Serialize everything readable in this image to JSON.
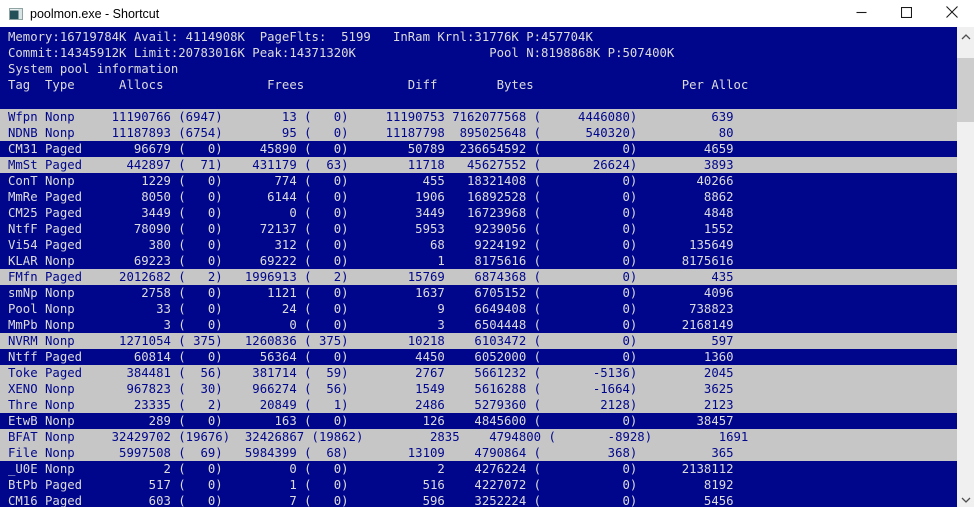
{
  "window": {
    "title": "poolmon.exe - Shortcut"
  },
  "console": {
    "status_lines": [
      "Memory:16719784K Avail: 4114908K  PageFlts:  5199   InRam Krnl:31776K P:457704K",
      "Commit:14345912K Limit:20783016K Peak:14371320K                  Pool N:8198868K P:507400K",
      "System pool information"
    ],
    "columns": [
      "Tag",
      "Type",
      "Allocs",
      "Frees",
      "Diff",
      "Bytes",
      "Per Alloc"
    ],
    "columns_header": "Tag  Type      Allocs              Frees              Diff        Bytes                    Per Alloc",
    "rows": [
      {
        "tag": "Wfpn",
        "type": "Nonp",
        "allocs": 11190766,
        "allocs_diff": 6947,
        "frees": 13,
        "frees_diff": 0,
        "diff": 11190753,
        "bytes": 7162077568,
        "bytes_diff": 4446080,
        "per_alloc": 639,
        "highlighted": true
      },
      {
        "tag": "NDNB",
        "type": "Nonp",
        "allocs": 11187893,
        "allocs_diff": 6754,
        "frees": 95,
        "frees_diff": 0,
        "diff": 11187798,
        "bytes": 895025648,
        "bytes_diff": 540320,
        "per_alloc": 80,
        "highlighted": true
      },
      {
        "tag": "CM31",
        "type": "Paged",
        "allocs": 96679,
        "allocs_diff": 0,
        "frees": 45890,
        "frees_diff": 0,
        "diff": 50789,
        "bytes": 236654592,
        "bytes_diff": 0,
        "per_alloc": 4659,
        "highlighted": false
      },
      {
        "tag": "MmSt",
        "type": "Paged",
        "allocs": 442897,
        "allocs_diff": 71,
        "frees": 431179,
        "frees_diff": 63,
        "diff": 11718,
        "bytes": 45627552,
        "bytes_diff": 26624,
        "per_alloc": 3893,
        "highlighted": true
      },
      {
        "tag": "ConT",
        "type": "Nonp",
        "allocs": 1229,
        "allocs_diff": 0,
        "frees": 774,
        "frees_diff": 0,
        "diff": 455,
        "bytes": 18321408,
        "bytes_diff": 0,
        "per_alloc": 40266,
        "highlighted": false
      },
      {
        "tag": "MmRe",
        "type": "Paged",
        "allocs": 8050,
        "allocs_diff": 0,
        "frees": 6144,
        "frees_diff": 0,
        "diff": 1906,
        "bytes": 16892528,
        "bytes_diff": 0,
        "per_alloc": 8862,
        "highlighted": false
      },
      {
        "tag": "CM25",
        "type": "Paged",
        "allocs": 3449,
        "allocs_diff": 0,
        "frees": 0,
        "frees_diff": 0,
        "diff": 3449,
        "bytes": 16723968,
        "bytes_diff": 0,
        "per_alloc": 4848,
        "highlighted": false
      },
      {
        "tag": "NtfF",
        "type": "Paged",
        "allocs": 78090,
        "allocs_diff": 0,
        "frees": 72137,
        "frees_diff": 0,
        "diff": 5953,
        "bytes": 9239056,
        "bytes_diff": 0,
        "per_alloc": 1552,
        "highlighted": false
      },
      {
        "tag": "Vi54",
        "type": "Paged",
        "allocs": 380,
        "allocs_diff": 0,
        "frees": 312,
        "frees_diff": 0,
        "diff": 68,
        "bytes": 9224192,
        "bytes_diff": 0,
        "per_alloc": 135649,
        "highlighted": false
      },
      {
        "tag": "KLAR",
        "type": "Nonp",
        "allocs": 69223,
        "allocs_diff": 0,
        "frees": 69222,
        "frees_diff": 0,
        "diff": 1,
        "bytes": 8175616,
        "bytes_diff": 0,
        "per_alloc": 8175616,
        "highlighted": false
      },
      {
        "tag": "FMfn",
        "type": "Paged",
        "allocs": 2012682,
        "allocs_diff": 2,
        "frees": 1996913,
        "frees_diff": 2,
        "diff": 15769,
        "bytes": 6874368,
        "bytes_diff": 0,
        "per_alloc": 435,
        "highlighted": true
      },
      {
        "tag": "smNp",
        "type": "Nonp",
        "allocs": 2758,
        "allocs_diff": 0,
        "frees": 1121,
        "frees_diff": 0,
        "diff": 1637,
        "bytes": 6705152,
        "bytes_diff": 0,
        "per_alloc": 4096,
        "highlighted": false
      },
      {
        "tag": "Pool",
        "type": "Nonp",
        "allocs": 33,
        "allocs_diff": 0,
        "frees": 24,
        "frees_diff": 0,
        "diff": 9,
        "bytes": 6649408,
        "bytes_diff": 0,
        "per_alloc": 738823,
        "highlighted": false
      },
      {
        "tag": "MmPb",
        "type": "Nonp",
        "allocs": 3,
        "allocs_diff": 0,
        "frees": 0,
        "frees_diff": 0,
        "diff": 3,
        "bytes": 6504448,
        "bytes_diff": 0,
        "per_alloc": 2168149,
        "highlighted": false
      },
      {
        "tag": "NVRM",
        "type": "Nonp",
        "allocs": 1271054,
        "allocs_diff": 375,
        "frees": 1260836,
        "frees_diff": 375,
        "diff": 10218,
        "bytes": 6103472,
        "bytes_diff": 0,
        "per_alloc": 597,
        "highlighted": true
      },
      {
        "tag": "Ntff",
        "type": "Paged",
        "allocs": 60814,
        "allocs_diff": 0,
        "frees": 56364,
        "frees_diff": 0,
        "diff": 4450,
        "bytes": 6052000,
        "bytes_diff": 0,
        "per_alloc": 1360,
        "highlighted": false
      },
      {
        "tag": "Toke",
        "type": "Paged",
        "allocs": 384481,
        "allocs_diff": 56,
        "frees": 381714,
        "frees_diff": 59,
        "diff": 2767,
        "bytes": 5661232,
        "bytes_diff": -5136,
        "per_alloc": 2045,
        "highlighted": true
      },
      {
        "tag": "XENO",
        "type": "Nonp",
        "allocs": 967823,
        "allocs_diff": 30,
        "frees": 966274,
        "frees_diff": 56,
        "diff": 1549,
        "bytes": 5616288,
        "bytes_diff": -1664,
        "per_alloc": 3625,
        "highlighted": true
      },
      {
        "tag": "Thre",
        "type": "Nonp",
        "allocs": 23335,
        "allocs_diff": 2,
        "frees": 20849,
        "frees_diff": 1,
        "diff": 2486,
        "bytes": 5279360,
        "bytes_diff": 2128,
        "per_alloc": 2123,
        "highlighted": true
      },
      {
        "tag": "EtwB",
        "type": "Nonp",
        "allocs": 289,
        "allocs_diff": 0,
        "frees": 163,
        "frees_diff": 0,
        "diff": 126,
        "bytes": 4845600,
        "bytes_diff": 0,
        "per_alloc": 38457,
        "highlighted": false
      },
      {
        "tag": "BFAT",
        "type": "Nonp",
        "allocs": 32429702,
        "allocs_diff": 19676,
        "frees": 32426867,
        "frees_diff": 19862,
        "diff": 2835,
        "bytes": 4794800,
        "bytes_diff": -8928,
        "per_alloc": 1691,
        "highlighted": true
      },
      {
        "tag": "File",
        "type": "Nonp",
        "allocs": 5997508,
        "allocs_diff": 69,
        "frees": 5984399,
        "frees_diff": 68,
        "diff": 13109,
        "bytes": 4790864,
        "bytes_diff": 368,
        "per_alloc": 365,
        "highlighted": true
      },
      {
        "tag": "_U0E",
        "type": "Nonp",
        "allocs": 2,
        "allocs_diff": 0,
        "frees": 0,
        "frees_diff": 0,
        "diff": 2,
        "bytes": 4276224,
        "bytes_diff": 0,
        "per_alloc": 2138112,
        "highlighted": false
      },
      {
        "tag": "BtPb",
        "type": "Paged",
        "allocs": 517,
        "allocs_diff": 0,
        "frees": 1,
        "frees_diff": 0,
        "diff": 516,
        "bytes": 4227072,
        "bytes_diff": 0,
        "per_alloc": 8192,
        "highlighted": false
      },
      {
        "tag": "CM16",
        "type": "Paged",
        "allocs": 603,
        "allocs_diff": 0,
        "frees": 7,
        "frees_diff": 0,
        "diff": 596,
        "bytes": 3252224,
        "bytes_diff": 0,
        "per_alloc": 5456,
        "highlighted": false
      }
    ]
  },
  "colors": {
    "console_bg": "#00068C",
    "highlight_bg": "#C6C6C6",
    "console_text": "#DCDCDC",
    "titlebar_bg": "#FFFFFF",
    "scrollbar_track": "#F0F0F0",
    "scrollbar_thumb": "#CDCDCD"
  }
}
